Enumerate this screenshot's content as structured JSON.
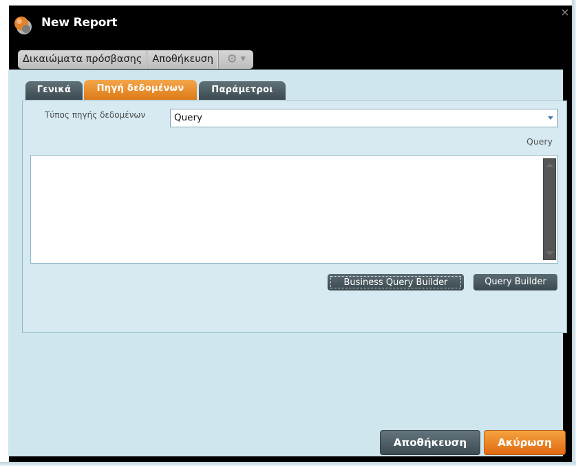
{
  "window": {
    "title": "New Report",
    "close_glyph": "×"
  },
  "toolbar": {
    "items": [
      {
        "label": "Δικαιώματα πρόσβασης"
      },
      {
        "label": "Αποθήκευση"
      }
    ],
    "settings_icon": "gear-icon",
    "settings_caret": "▼"
  },
  "tabs": [
    {
      "label": "Γενικά",
      "active": false
    },
    {
      "label": "Πηγή δεδομένων",
      "active": true
    },
    {
      "label": "Παράμετροι",
      "active": false
    }
  ],
  "datasource": {
    "label": "Τύπος πηγής δεδομένων",
    "value": "Query"
  },
  "query": {
    "label": "Query",
    "value": ""
  },
  "buttons": {
    "business_query_builder": "Business Query Builder",
    "query_builder": "Query Builder",
    "save": "Αποθήκευση",
    "cancel": "Ακύρωση"
  },
  "colors": {
    "accent_orange": "#e07a1a",
    "panel_bg": "#cfe6ee",
    "dark_button": "#3f4d54"
  }
}
